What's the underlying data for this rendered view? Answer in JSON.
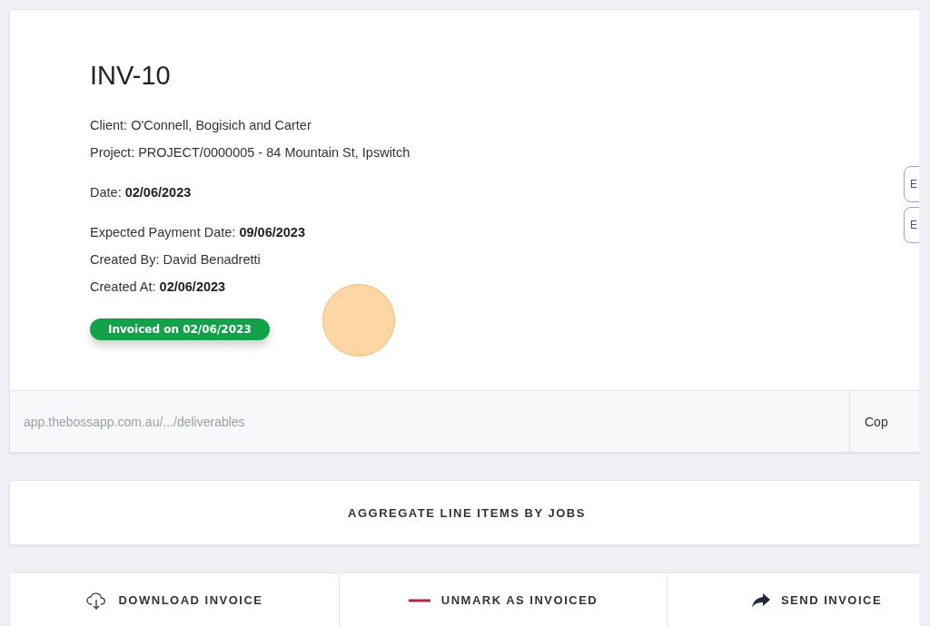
{
  "invoice": {
    "title": "INV-10",
    "lines": [
      {
        "kind": "plain",
        "text": "Client: O'Connell, Bogisich and Carter"
      },
      {
        "kind": "plain",
        "text": "Project: PROJECT/0000005 - 84 Mountain St, Ipswitch"
      },
      {
        "kind": "gap",
        "text": "Date: **02/06/2023**"
      },
      {
        "kind": "gap",
        "text": "Expected Payment Date: **09/06/2023**"
      },
      {
        "kind": "plain",
        "text": "Created By: David Benadretti"
      },
      {
        "kind": "plain",
        "text": "Created At: **02/06/2023**"
      }
    ],
    "status_badge": "Invoiced on 02/06/2023",
    "side_buttons": [
      "E",
      "E"
    ],
    "link": "app.thebossapp.com.au/.../deliverables",
    "copy_button": "Cop"
  },
  "aggregate_button": "AGGREGATE LINE ITEMS BY JOBS",
  "actions": [
    {
      "kind": "download",
      "label": "DOWNLOAD INVOICE"
    },
    {
      "kind": "unmark",
      "label": "UNMARK AS INVOICED"
    },
    {
      "kind": "send",
      "label": "SEND INVOICE"
    }
  ]
}
